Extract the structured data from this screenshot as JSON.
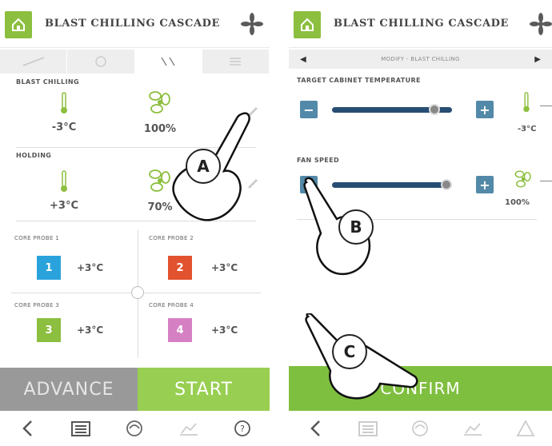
{
  "left_screen": {
    "header": {
      "title": "BLAST CHILLING CASCADE"
    },
    "tabs": [
      "",
      "",
      "",
      ""
    ],
    "blast_chilling": {
      "label": "BLAST CHILLING",
      "temperature": "-3°C",
      "fan": "100%"
    },
    "holding": {
      "label": "HOLDING",
      "temperature": "+3°C",
      "fan": "70%"
    },
    "probes": [
      {
        "label": "CORE PROBE 1",
        "number": "1",
        "value": "+3°C",
        "color": "#2aa3dc"
      },
      {
        "label": "CORE PROBE 2",
        "number": "2",
        "value": "+3°C",
        "color": "#e2522f"
      },
      {
        "label": "CORE PROBE 3",
        "number": "3",
        "value": "+3°C",
        "color": "#8cbf3f"
      },
      {
        "label": "CORE PROBE 4",
        "number": "4",
        "value": "+3°C",
        "color": "#d680c4"
      }
    ],
    "buttons": {
      "advance": "ADVANCE",
      "start": "START"
    }
  },
  "right_screen": {
    "header": {
      "title": "BLAST CHILLING CASCADE"
    },
    "mode_bar": {
      "text": "MODIFY - BLAST CHILLING"
    },
    "target_temperature": {
      "label": "TARGET CABINET TEMPERATURE",
      "value": "-3°C",
      "level": 0.85
    },
    "fan_speed": {
      "label": "FAN SPEED",
      "value": "100%",
      "level": 0.95
    },
    "buttons": {
      "confirm": "CONFIRM"
    }
  },
  "annotations": {
    "a": "A",
    "b": "B",
    "c": "C"
  },
  "colors": {
    "accent_green": "#8cbf3f",
    "slider_blue": "#274d72",
    "button_blue": "#5389a8",
    "grey_button": "#999999"
  }
}
